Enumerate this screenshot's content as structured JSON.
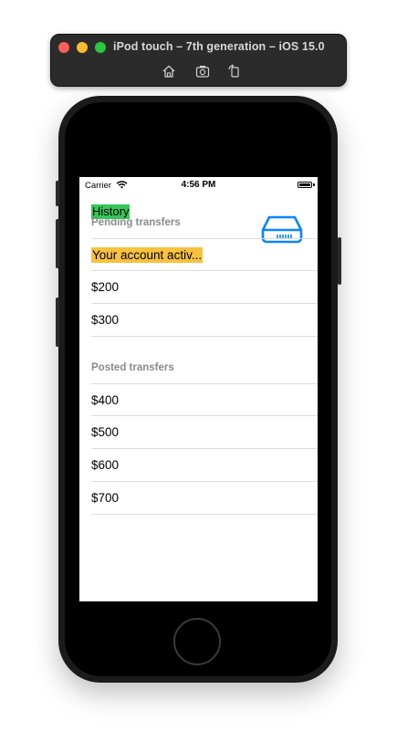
{
  "simulator": {
    "title": "iPod touch – 7th generation – iOS 15.0",
    "tools": [
      "home-icon",
      "screenshot-icon",
      "rotate-icon"
    ]
  },
  "status_bar": {
    "carrier": "Carrier",
    "time": "4:56 PM"
  },
  "app": {
    "history_label": "History",
    "colors": {
      "history_bg": "#34c759",
      "highlight_bg": "#f7c23e",
      "icon_blue": "#0a84ff"
    },
    "sections": [
      {
        "header": "Pending transfers",
        "rows": [
          "Your account activ...",
          "$200",
          "$300"
        ]
      },
      {
        "header": "Posted transfers",
        "rows": [
          "$400",
          "$500",
          "$600",
          "$700"
        ]
      }
    ]
  }
}
